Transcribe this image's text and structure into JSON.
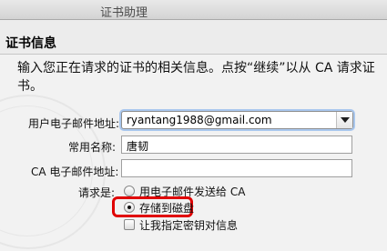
{
  "window": {
    "title": "证书助理"
  },
  "section": {
    "title": "证书信息",
    "intro": "输入您正在请求的证书的相关信息。点按“继续”以从 CA 请求证书。"
  },
  "form": {
    "email_label": "用户电子邮件地址:",
    "email_value": "ryantang1988@gmail.com",
    "common_name_label": "常用名称:",
    "common_name_value": "唐韧",
    "ca_email_label": "CA 电子邮件地址:",
    "ca_email_value": "",
    "request_label": "请求是:",
    "request_options": [
      {
        "label": "用电子邮件发送给 CA",
        "selected": false
      },
      {
        "label": "存储到磁盘",
        "selected": true
      }
    ],
    "custom_key_label": "让我指定密钥对信息",
    "custom_key_checked": false
  },
  "colors": {
    "highlight": "#e00000",
    "focus_ring": "#a9c7ee"
  },
  "icons": {
    "dropdown": "chevron-down-icon"
  }
}
